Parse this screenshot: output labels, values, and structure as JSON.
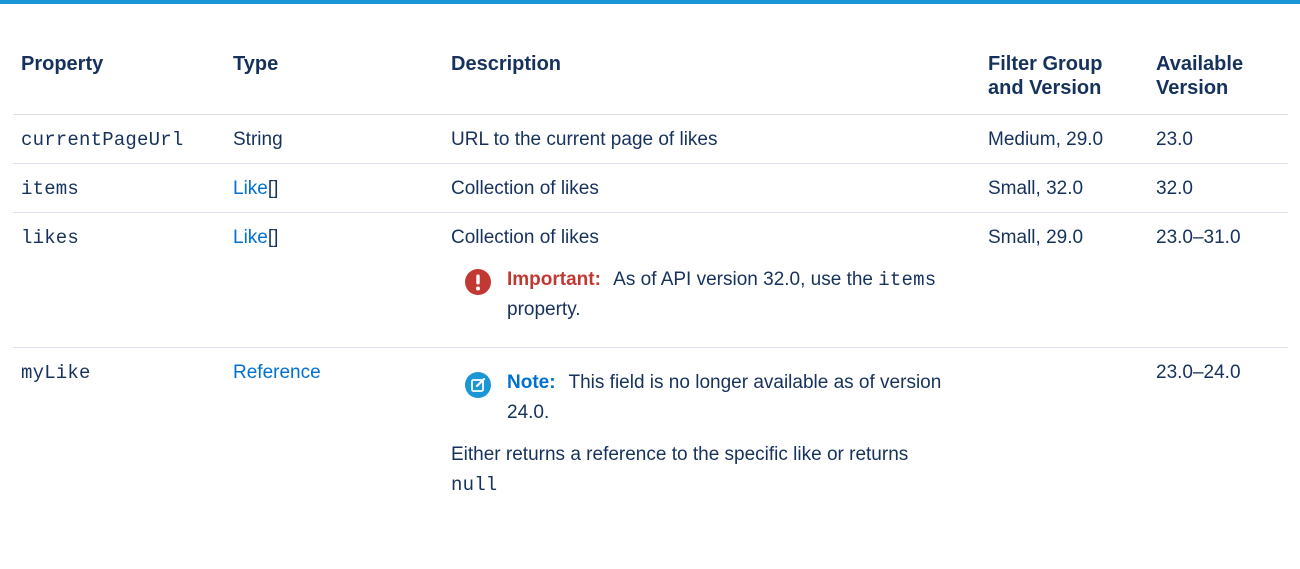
{
  "table": {
    "headers": {
      "property": "Property",
      "type": "Type",
      "description": "Description",
      "filter_line1": "Filter Group",
      "filter_line2": "and Version",
      "available_line1": "Available",
      "available_line2": "Version"
    },
    "rows": [
      {
        "property": "currentPageUrl",
        "type": "String",
        "description": "URL to the current page of likes",
        "filter": "Medium, 29.0",
        "available": "23.0"
      },
      {
        "property": "items",
        "type_link": "Like",
        "type_suffix": "[]",
        "description": "Collection of likes",
        "filter": "Small, 32.0",
        "available": "32.0"
      },
      {
        "property": "likes",
        "type_link": "Like",
        "type_suffix": "[]",
        "description": "Collection of likes",
        "callout_label": "Important:",
        "callout_text_before": "As of API version 32.0, use the",
        "callout_code": "items",
        "callout_text_after": "property.",
        "filter": "Small, 29.0",
        "available": "23.0–31.0"
      },
      {
        "property": "myLike",
        "type_link": "Reference",
        "callout_label": "Note:",
        "callout_text": "This field is no longer available as of version 24.0.",
        "description_text": "Either returns a reference to the specific like or returns",
        "description_code": "null",
        "filter": "",
        "available": "23.0–24.0"
      }
    ]
  },
  "colors": {
    "accent_rule": "#1b96d6",
    "link": "#0070d2",
    "important": "#c23934",
    "note": "#1b96d6",
    "text": "#16325c"
  },
  "icons": {
    "important": "exclamation-circle-icon",
    "note": "edit-note-icon"
  }
}
